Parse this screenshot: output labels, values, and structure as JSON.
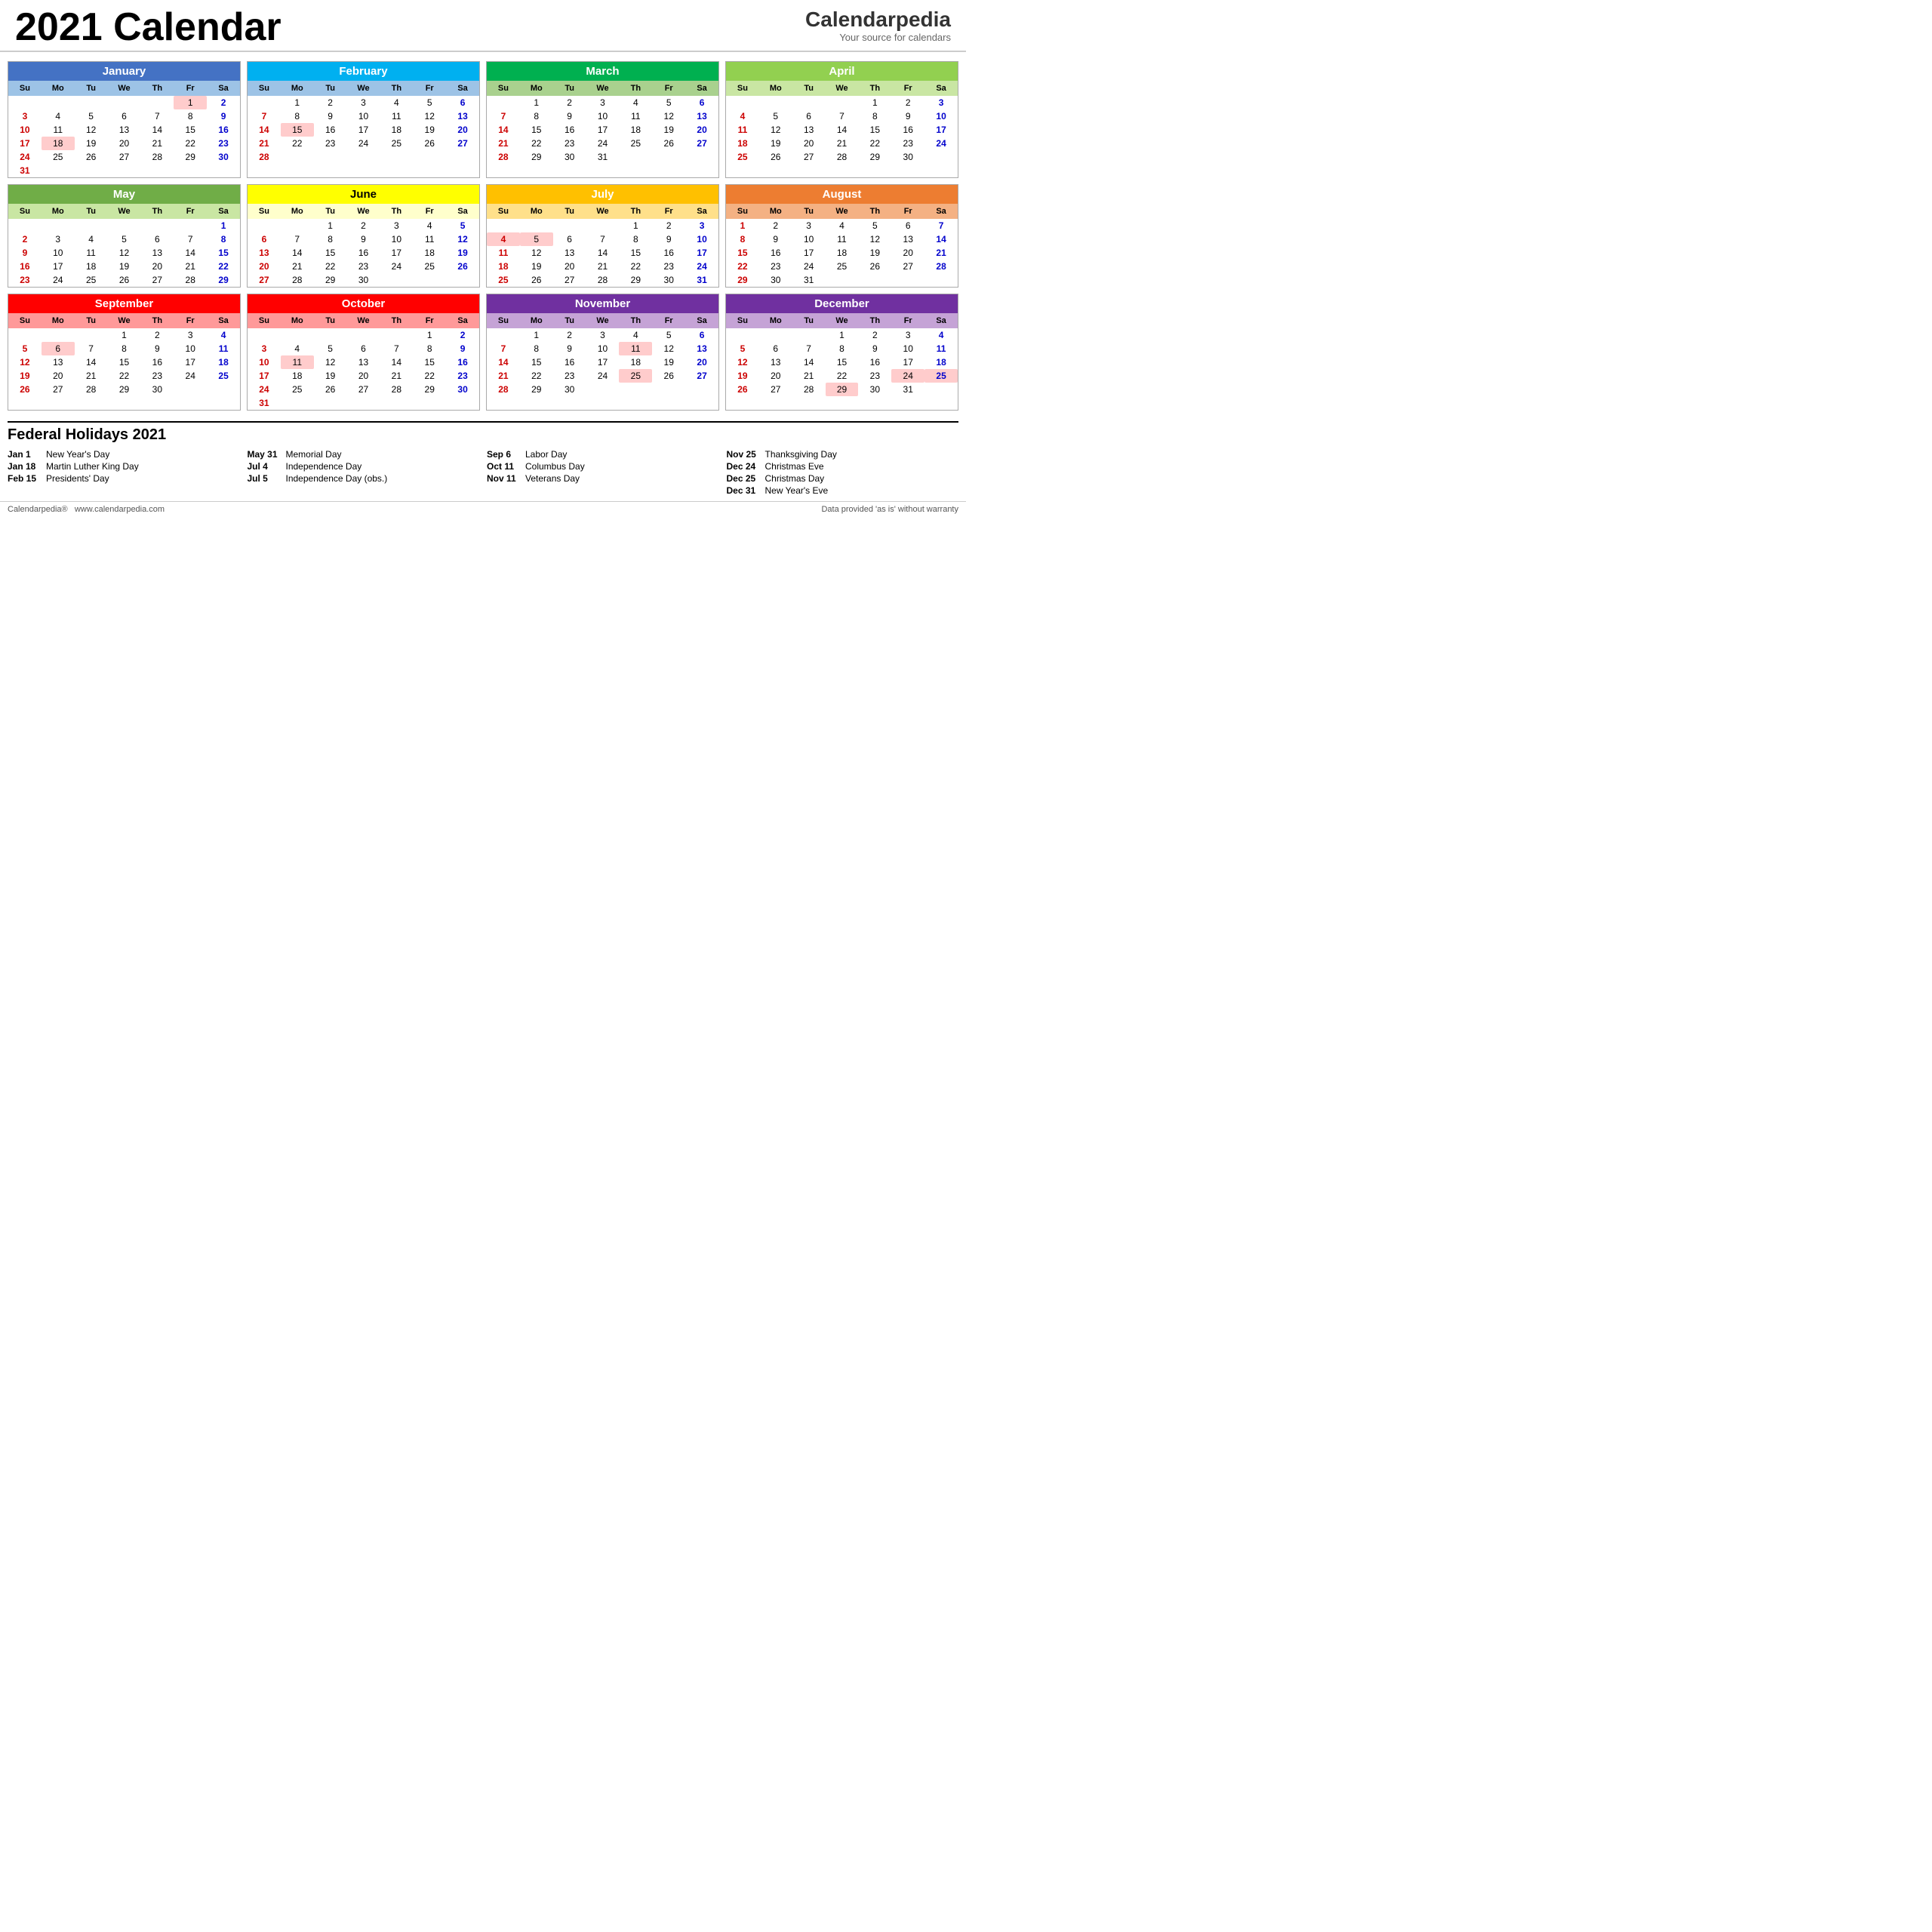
{
  "header": {
    "title": "2021 Calendar",
    "logo_name": "Calendarpedia",
    "logo_tagline": "Your source for calendars"
  },
  "months": [
    {
      "name": "January",
      "theme": "jan",
      "days_header": [
        "Su",
        "Mo",
        "Tu",
        "We",
        "Th",
        "Fr",
        "Sa"
      ],
      "weeks": [
        [
          null,
          null,
          null,
          null,
          null,
          {
            "n": 1,
            "type": "holiday"
          },
          {
            "n": 2,
            "type": "sat"
          }
        ],
        [
          {
            "n": 3,
            "type": "sun"
          },
          4,
          5,
          6,
          7,
          8,
          {
            "n": 9,
            "type": "sat"
          }
        ],
        [
          {
            "n": 10,
            "type": "sun"
          },
          11,
          12,
          13,
          14,
          15,
          {
            "n": 16,
            "type": "sat"
          }
        ],
        [
          {
            "n": 17,
            "type": "sun"
          },
          {
            "n": 18,
            "type": "holiday"
          },
          19,
          20,
          21,
          22,
          {
            "n": 23,
            "type": "sat"
          }
        ],
        [
          {
            "n": 24,
            "type": "sun"
          },
          25,
          26,
          27,
          28,
          29,
          {
            "n": 30,
            "type": "sat"
          }
        ],
        [
          {
            "n": 31,
            "type": "sun"
          },
          null,
          null,
          null,
          null,
          null,
          null
        ]
      ]
    },
    {
      "name": "February",
      "theme": "feb",
      "days_header": [
        "Su",
        "Mo",
        "Tu",
        "We",
        "Th",
        "Fr",
        "Sa"
      ],
      "weeks": [
        [
          null,
          1,
          2,
          3,
          4,
          5,
          {
            "n": 6,
            "type": "sat"
          }
        ],
        [
          {
            "n": 7,
            "type": "sun"
          },
          8,
          9,
          10,
          11,
          12,
          {
            "n": 13,
            "type": "sat"
          }
        ],
        [
          {
            "n": 14,
            "type": "sun"
          },
          {
            "n": 15,
            "type": "holiday"
          },
          16,
          17,
          18,
          19,
          {
            "n": 20,
            "type": "sat"
          }
        ],
        [
          {
            "n": 21,
            "type": "sun"
          },
          22,
          23,
          24,
          25,
          26,
          {
            "n": 27,
            "type": "sat"
          }
        ],
        [
          {
            "n": 28,
            "type": "sun"
          },
          null,
          null,
          null,
          null,
          null,
          null
        ]
      ]
    },
    {
      "name": "March",
      "theme": "mar",
      "days_header": [
        "Su",
        "Mo",
        "Tu",
        "We",
        "Th",
        "Fr",
        "Sa"
      ],
      "weeks": [
        [
          null,
          1,
          2,
          3,
          4,
          5,
          {
            "n": 6,
            "type": "sat"
          }
        ],
        [
          {
            "n": 7,
            "type": "sun"
          },
          8,
          9,
          10,
          11,
          12,
          {
            "n": 13,
            "type": "sat"
          }
        ],
        [
          {
            "n": 14,
            "type": "sun"
          },
          15,
          16,
          17,
          18,
          19,
          {
            "n": 20,
            "type": "sat"
          }
        ],
        [
          {
            "n": 21,
            "type": "sun"
          },
          22,
          23,
          24,
          25,
          26,
          {
            "n": 27,
            "type": "sat"
          }
        ],
        [
          {
            "n": 28,
            "type": "sun"
          },
          29,
          30,
          31,
          null,
          null,
          null
        ]
      ]
    },
    {
      "name": "April",
      "theme": "apr",
      "days_header": [
        "Su",
        "Mo",
        "Tu",
        "We",
        "Th",
        "Fr",
        "Sa"
      ],
      "weeks": [
        [
          null,
          null,
          null,
          null,
          1,
          2,
          {
            "n": 3,
            "type": "sat"
          }
        ],
        [
          {
            "n": 4,
            "type": "sun"
          },
          5,
          6,
          7,
          8,
          9,
          {
            "n": 10,
            "type": "sat"
          }
        ],
        [
          {
            "n": 11,
            "type": "sun"
          },
          12,
          13,
          14,
          15,
          16,
          {
            "n": 17,
            "type": "sat"
          }
        ],
        [
          {
            "n": 18,
            "type": "sun"
          },
          19,
          20,
          21,
          22,
          23,
          {
            "n": 24,
            "type": "sat"
          }
        ],
        [
          {
            "n": 25,
            "type": "sun"
          },
          26,
          27,
          28,
          29,
          30,
          null
        ]
      ]
    },
    {
      "name": "May",
      "theme": "may",
      "days_header": [
        "Su",
        "Mo",
        "Tu",
        "We",
        "Th",
        "Fr",
        "Sa"
      ],
      "weeks": [
        [
          null,
          null,
          null,
          null,
          null,
          null,
          {
            "n": 1,
            "type": "sat"
          }
        ],
        [
          {
            "n": 2,
            "type": "sun"
          },
          3,
          4,
          5,
          6,
          7,
          {
            "n": 8,
            "type": "sat"
          }
        ],
        [
          {
            "n": 9,
            "type": "sun"
          },
          10,
          11,
          12,
          13,
          14,
          {
            "n": 15,
            "type": "sat"
          }
        ],
        [
          {
            "n": 16,
            "type": "sun"
          },
          17,
          18,
          19,
          20,
          21,
          {
            "n": 22,
            "type": "sat"
          }
        ],
        [
          {
            "n": 23,
            "type": "sun"
          },
          24,
          25,
          26,
          27,
          28,
          {
            "n": 29,
            "type": "sat"
          }
        ]
      ]
    },
    {
      "name": "June",
      "theme": "jun",
      "days_header": [
        "Su",
        "Mo",
        "Tu",
        "We",
        "Th",
        "Fr",
        "Sa"
      ],
      "weeks": [
        [
          null,
          null,
          1,
          2,
          3,
          4,
          {
            "n": 5,
            "type": "sat"
          }
        ],
        [
          {
            "n": 6,
            "type": "sun"
          },
          7,
          8,
          9,
          10,
          11,
          {
            "n": 12,
            "type": "sat"
          }
        ],
        [
          {
            "n": 13,
            "type": "sun"
          },
          14,
          15,
          16,
          17,
          18,
          {
            "n": 19,
            "type": "sat"
          }
        ],
        [
          {
            "n": 20,
            "type": "sun"
          },
          21,
          22,
          23,
          24,
          25,
          {
            "n": 26,
            "type": "sat"
          }
        ],
        [
          {
            "n": 27,
            "type": "sun"
          },
          28,
          29,
          30,
          null,
          null,
          null
        ]
      ]
    },
    {
      "name": "July",
      "theme": "jul",
      "days_header": [
        "Su",
        "Mo",
        "Tu",
        "We",
        "Th",
        "Fr",
        "Sa"
      ],
      "weeks": [
        [
          null,
          null,
          null,
          null,
          1,
          2,
          {
            "n": 3,
            "type": "sat"
          }
        ],
        [
          {
            "n": 4,
            "type": "holiday-sun"
          },
          {
            "n": 5,
            "type": "holiday"
          },
          6,
          7,
          8,
          9,
          {
            "n": 10,
            "type": "sat"
          }
        ],
        [
          {
            "n": 11,
            "type": "sun"
          },
          12,
          13,
          14,
          15,
          16,
          {
            "n": 17,
            "type": "sat"
          }
        ],
        [
          {
            "n": 18,
            "type": "sun"
          },
          19,
          20,
          21,
          22,
          23,
          {
            "n": 24,
            "type": "sat"
          }
        ],
        [
          {
            "n": 25,
            "type": "sun"
          },
          26,
          27,
          28,
          29,
          30,
          {
            "n": 31,
            "type": "sat"
          }
        ]
      ]
    },
    {
      "name": "August",
      "theme": "aug",
      "days_header": [
        "Su",
        "Mo",
        "Tu",
        "We",
        "Th",
        "Fr",
        "Sa"
      ],
      "weeks": [
        [
          {
            "n": 1,
            "type": "sun"
          },
          2,
          3,
          4,
          5,
          6,
          {
            "n": 7,
            "type": "sat"
          }
        ],
        [
          {
            "n": 8,
            "type": "sun"
          },
          9,
          10,
          11,
          12,
          13,
          {
            "n": 14,
            "type": "sat"
          }
        ],
        [
          {
            "n": 15,
            "type": "sun"
          },
          16,
          17,
          18,
          19,
          20,
          {
            "n": 21,
            "type": "sat"
          }
        ],
        [
          {
            "n": 22,
            "type": "sun"
          },
          23,
          24,
          25,
          26,
          27,
          {
            "n": 28,
            "type": "sat"
          }
        ],
        [
          {
            "n": 29,
            "type": "sun"
          },
          30,
          31,
          null,
          null,
          null,
          null
        ]
      ]
    },
    {
      "name": "September",
      "theme": "sep",
      "days_header": [
        "Su",
        "Mo",
        "Tu",
        "We",
        "Th",
        "Fr",
        "Sa"
      ],
      "weeks": [
        [
          null,
          null,
          null,
          1,
          2,
          3,
          {
            "n": 4,
            "type": "sat"
          }
        ],
        [
          {
            "n": 5,
            "type": "sun"
          },
          {
            "n": 6,
            "type": "holiday"
          },
          7,
          8,
          9,
          10,
          {
            "n": 11,
            "type": "sat"
          }
        ],
        [
          {
            "n": 12,
            "type": "sun"
          },
          13,
          14,
          15,
          16,
          17,
          {
            "n": 18,
            "type": "sat"
          }
        ],
        [
          {
            "n": 19,
            "type": "sun"
          },
          20,
          21,
          22,
          23,
          24,
          {
            "n": 25,
            "type": "sat"
          }
        ],
        [
          {
            "n": 26,
            "type": "sun"
          },
          27,
          28,
          29,
          30,
          null,
          null
        ]
      ]
    },
    {
      "name": "October",
      "theme": "oct",
      "days_header": [
        "Su",
        "Mo",
        "Tu",
        "We",
        "Th",
        "Fr",
        "Sa"
      ],
      "weeks": [
        [
          null,
          null,
          null,
          null,
          null,
          1,
          {
            "n": 2,
            "type": "sat"
          }
        ],
        [
          {
            "n": 3,
            "type": "sun"
          },
          4,
          5,
          6,
          7,
          8,
          {
            "n": 9,
            "type": "sat"
          }
        ],
        [
          {
            "n": 10,
            "type": "sun"
          },
          {
            "n": 11,
            "type": "holiday"
          },
          12,
          13,
          14,
          15,
          {
            "n": 16,
            "type": "sat"
          }
        ],
        [
          {
            "n": 17,
            "type": "sun"
          },
          18,
          19,
          20,
          21,
          22,
          {
            "n": 23,
            "type": "sat"
          }
        ],
        [
          {
            "n": 24,
            "type": "sun"
          },
          25,
          26,
          27,
          28,
          29,
          {
            "n": 30,
            "type": "sat"
          }
        ],
        [
          {
            "n": 31,
            "type": "sun"
          },
          null,
          null,
          null,
          null,
          null,
          null
        ]
      ]
    },
    {
      "name": "November",
      "theme": "nov",
      "days_header": [
        "Su",
        "Mo",
        "Tu",
        "We",
        "Th",
        "Fr",
        "Sa"
      ],
      "weeks": [
        [
          null,
          1,
          2,
          3,
          4,
          5,
          {
            "n": 6,
            "type": "sat"
          }
        ],
        [
          {
            "n": 7,
            "type": "sun"
          },
          8,
          9,
          10,
          {
            "n": 11,
            "type": "holiday"
          },
          12,
          {
            "n": 13,
            "type": "sat"
          }
        ],
        [
          {
            "n": 14,
            "type": "sun"
          },
          15,
          16,
          17,
          18,
          19,
          {
            "n": 20,
            "type": "sat"
          }
        ],
        [
          {
            "n": 21,
            "type": "sun"
          },
          22,
          23,
          24,
          {
            "n": 25,
            "type": "holiday"
          },
          26,
          {
            "n": 27,
            "type": "sat"
          }
        ],
        [
          {
            "n": 28,
            "type": "sun"
          },
          29,
          30,
          null,
          null,
          null,
          null
        ]
      ]
    },
    {
      "name": "December",
      "theme": "dec",
      "days_header": [
        "Su",
        "Mo",
        "Tu",
        "We",
        "Th",
        "Fr",
        "Sa"
      ],
      "weeks": [
        [
          null,
          null,
          null,
          1,
          2,
          3,
          {
            "n": 4,
            "type": "sat"
          }
        ],
        [
          {
            "n": 5,
            "type": "sun"
          },
          6,
          7,
          8,
          9,
          10,
          {
            "n": 11,
            "type": "sat"
          }
        ],
        [
          {
            "n": 12,
            "type": "sun"
          },
          13,
          14,
          15,
          16,
          17,
          {
            "n": 18,
            "type": "sat"
          }
        ],
        [
          {
            "n": 19,
            "type": "sun"
          },
          20,
          21,
          22,
          23,
          {
            "n": 24,
            "type": "holiday"
          },
          {
            "n": 25,
            "type": "sat-holiday"
          }
        ],
        [
          {
            "n": 26,
            "type": "sun"
          },
          27,
          28,
          {
            "n": 29,
            "type": "holiday"
          },
          30,
          31,
          null
        ]
      ]
    }
  ],
  "holidays_title": "Federal Holidays 2021",
  "holidays": [
    [
      {
        "date": "Jan 1",
        "name": "New Year's Day"
      },
      {
        "date": "Jan 18",
        "name": "Martin Luther King Day"
      },
      {
        "date": "Feb 15",
        "name": "Presidents' Day"
      }
    ],
    [
      {
        "date": "May 31",
        "name": "Memorial Day"
      },
      {
        "date": "Jul 4",
        "name": "Independence Day"
      },
      {
        "date": "Jul 5",
        "name": "Independence Day (obs.)"
      }
    ],
    [
      {
        "date": "Sep 6",
        "name": "Labor Day"
      },
      {
        "date": "Oct 11",
        "name": "Columbus Day"
      },
      {
        "date": "Nov 11",
        "name": "Veterans Day"
      }
    ],
    [
      {
        "date": "Nov 25",
        "name": "Thanksgiving Day"
      },
      {
        "date": "Dec 24",
        "name": "Christmas Eve"
      },
      {
        "date": "Dec 25",
        "name": "Christmas Day"
      },
      {
        "date": "Dec 31",
        "name": "New Year's Eve"
      }
    ]
  ],
  "footer": {
    "logo": "Calendarpedia®",
    "url": "www.calendarpedia.com",
    "note": "Data provided 'as is' without warranty"
  }
}
